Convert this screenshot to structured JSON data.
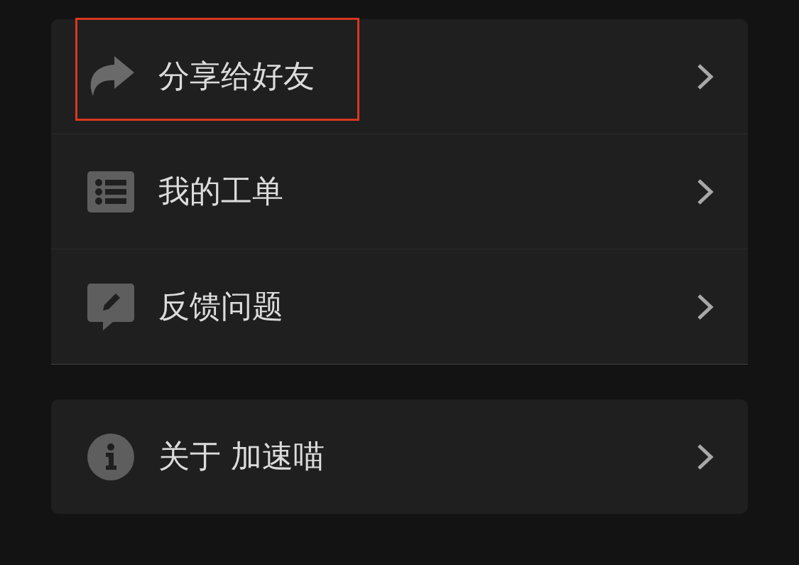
{
  "groups": [
    {
      "items": [
        {
          "label": "分享给好友",
          "kind": "share",
          "highlighted": true
        },
        {
          "label": "我的工单",
          "kind": "list",
          "highlighted": false
        },
        {
          "label": "反馈问题",
          "kind": "feedback",
          "highlighted": false
        }
      ]
    },
    {
      "items": [
        {
          "label": "关于 加速喵",
          "kind": "info",
          "highlighted": false
        }
      ]
    }
  ]
}
